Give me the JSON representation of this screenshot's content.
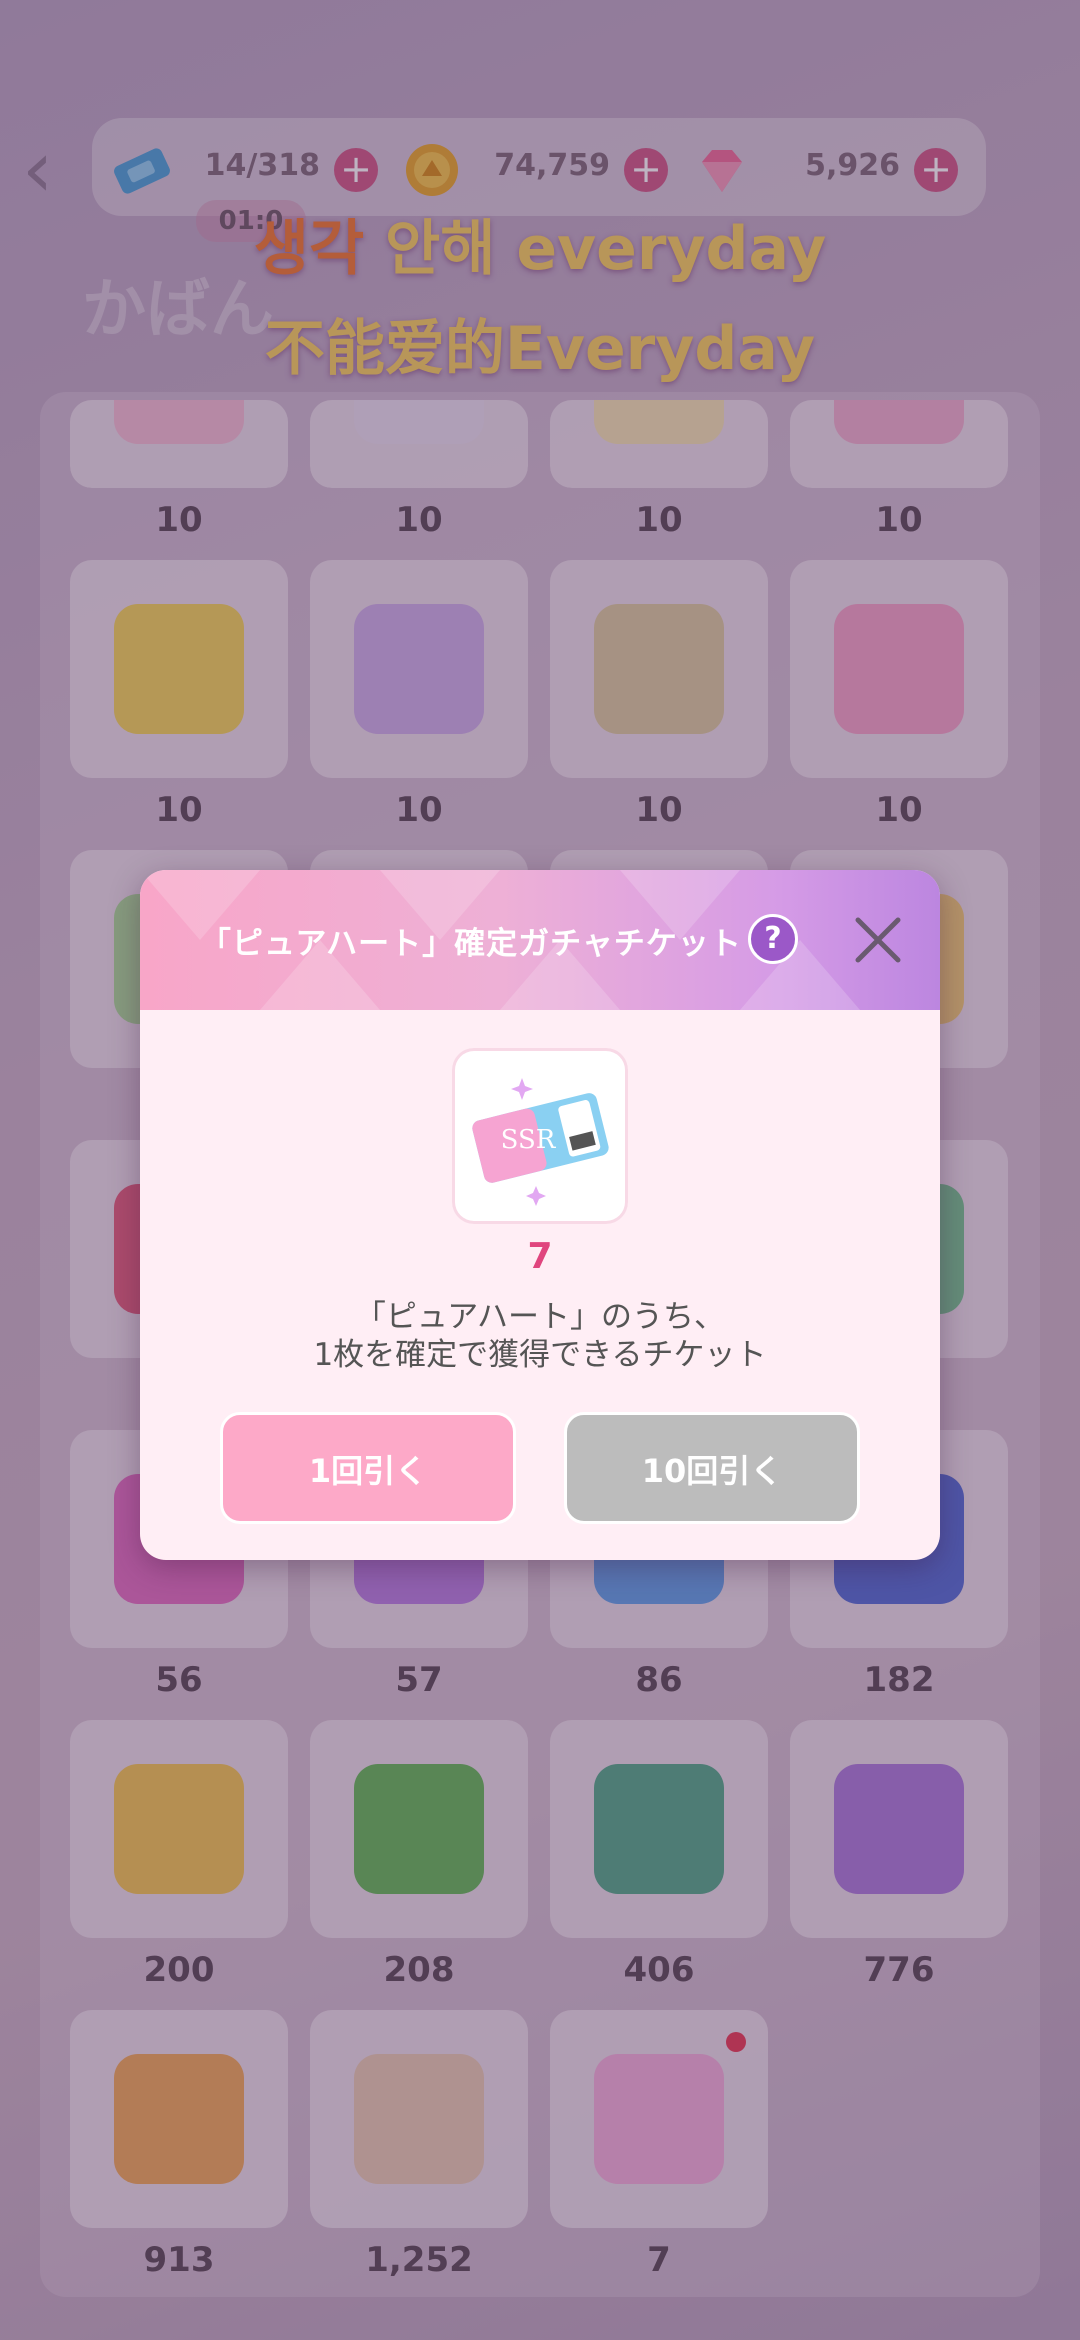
{
  "header": {
    "back_label": "‹",
    "title": "かばん",
    "timer": "01:0",
    "resources": [
      {
        "icon": "ticket-icon",
        "value": "14/318"
      },
      {
        "icon": "gold-coin-icon",
        "value": "74,759"
      },
      {
        "icon": "diamond-icon",
        "value": "5,926"
      }
    ],
    "plus_label": "+"
  },
  "lyrics": {
    "line1_highlight": "생각",
    "line1_rest": " 안해 everyday",
    "line2": "不能爱的Everyday"
  },
  "inventory": {
    "counts": [
      "10",
      "10",
      "10",
      "10",
      "10",
      "10",
      "10",
      "10",
      "",
      "",
      "",
      "",
      "",
      "",
      "",
      "",
      "56",
      "57",
      "86",
      "182",
      "200",
      "208",
      "406",
      "776",
      "913",
      "1,252",
      "7"
    ],
    "accent_pink": "#d05a86"
  },
  "modal": {
    "title": "「ピュアハート」確定ガチャチケット",
    "help_label": "?",
    "ticket_label": "SSR",
    "quantity": "7",
    "description_line1": "「ピュアハート」のうち、",
    "description_line2": "1枚を確定で獲得できるチケット",
    "draw1_label": "1回引く",
    "draw10_label": "10回引く"
  }
}
